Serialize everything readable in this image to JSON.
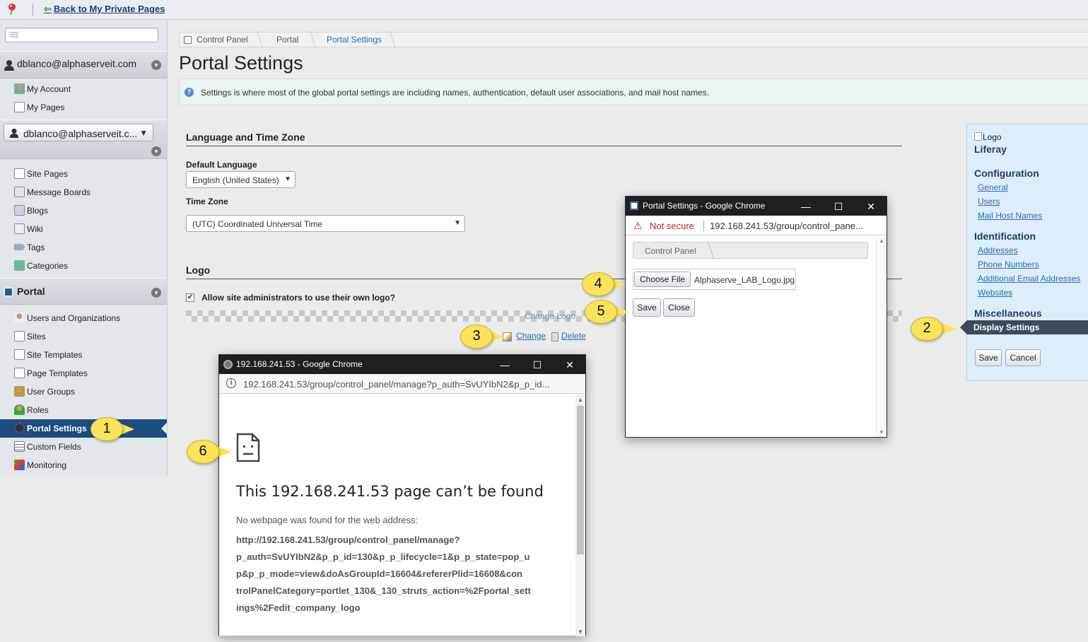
{
  "topbar": {
    "back_label": "Back to My Private Pages"
  },
  "sidebar": {
    "user_header": "dblanco@alphaserveit.com",
    "user_items": [
      "My Account",
      "My Pages"
    ],
    "site_select": "dblanco@alphaserveit.c...",
    "site_items": [
      "Site Pages",
      "Message Boards",
      "Blogs",
      "Wiki",
      "Tags",
      "Categories"
    ],
    "portal_header": "Portal",
    "portal_items": [
      "Users and Organizations",
      "Sites",
      "Site Templates",
      "Page Templates",
      "User Groups",
      "Roles",
      "Portal Settings",
      "Custom Fields",
      "Monitoring"
    ],
    "active_item": "Portal Settings"
  },
  "breadcrumb": [
    "Control Panel",
    "Portal",
    "Portal Settings"
  ],
  "page": {
    "title": "Portal Settings",
    "info": "Settings is where most of the global portal settings are including names, authentication, default user associations, and mail host names."
  },
  "language_section": {
    "title": "Language and Time Zone",
    "default_language_label": "Default Language",
    "default_language_value": "English (United States)",
    "time_zone_label": "Time Zone",
    "time_zone_value": "(UTC) Coordinated Universal Time"
  },
  "logo_section": {
    "title": "Logo",
    "allow_label": "Allow site administrators to use their own logo?",
    "allow_checked": true,
    "change_logo_text": "Change Logo",
    "change_label": "Change",
    "delete_label": "Delete"
  },
  "right_panel": {
    "logo_alt": "Logo",
    "brand": "Liferay",
    "configuration": {
      "title": "Configuration",
      "links": [
        "General",
        "Users",
        "Mail Host Names"
      ]
    },
    "identification": {
      "title": "Identification",
      "links": [
        "Addresses",
        "Phone Numbers",
        "Additional Email Addresses",
        "Websites"
      ]
    },
    "miscellaneous": {
      "title": "Miscellaneous",
      "links": [
        "Display Settings"
      ]
    },
    "save_label": "Save",
    "cancel_label": "Cancel"
  },
  "popup_settings": {
    "title": "Portal Settings - Google Chrome",
    "not_secure": "Not secure",
    "url": "192.168.241.53/group/control_pane...",
    "breadcrumb": "Control Panel",
    "choose_file_label": "Choose File",
    "file_name": "Alphaserve_LAB_Logo.jpg",
    "save_label": "Save",
    "close_label": "Close"
  },
  "popup_error": {
    "title": "192.168.241.53 - Google Chrome",
    "url": "192.168.241.53/group/control_panel/manage?p_auth=SvUYIbN2&p_p_id...",
    "heading": "This 192.168.241.53 page can’t be found",
    "message": "No webpage was found for the web address:",
    "address_lines": [
      "http://192.168.241.53/group/control_panel/manage?",
      "p_auth=SvUYIbN2&p_p_id=130&p_p_lifecycle=1&p_p_state=pop_u",
      "p&p_p_mode=view&doAsGroupId=16604&refererPlid=16608&con",
      "trolPanelCategory=portlet_130&_130_struts_action=%2Fportal_sett",
      "ings%2Fedit_company_logo"
    ]
  },
  "callouts": [
    "1",
    "2",
    "3",
    "4",
    "5",
    "6"
  ],
  "colors": {
    "accent": "#1c4d7e",
    "callout": "#fbe35a",
    "link": "#2b6cb5"
  }
}
